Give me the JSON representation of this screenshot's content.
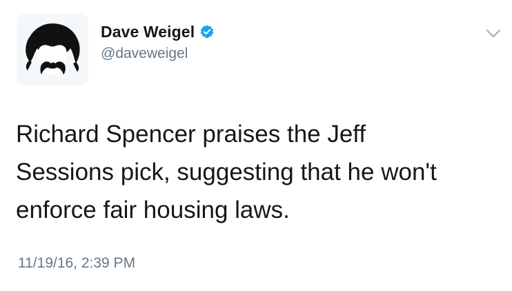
{
  "author": {
    "display_name": "Dave Weigel",
    "handle": "@daveweigel",
    "verified": true,
    "avatar_icon": "bearded-man-silhouette-icon"
  },
  "tweet": {
    "text": "Richard Spencer praises the Jeff\nSessions pick, suggesting that he won't\nenforce fair housing laws.",
    "timestamp": "11/19/16, 2:39 PM"
  },
  "icons": {
    "verified": "verified-badge-icon",
    "menu": "chevron-down-icon"
  },
  "colors": {
    "verified_blue": "#1da1f2",
    "text_primary": "#14171a",
    "text_secondary": "#657786",
    "chevron": "#aab8c2"
  }
}
